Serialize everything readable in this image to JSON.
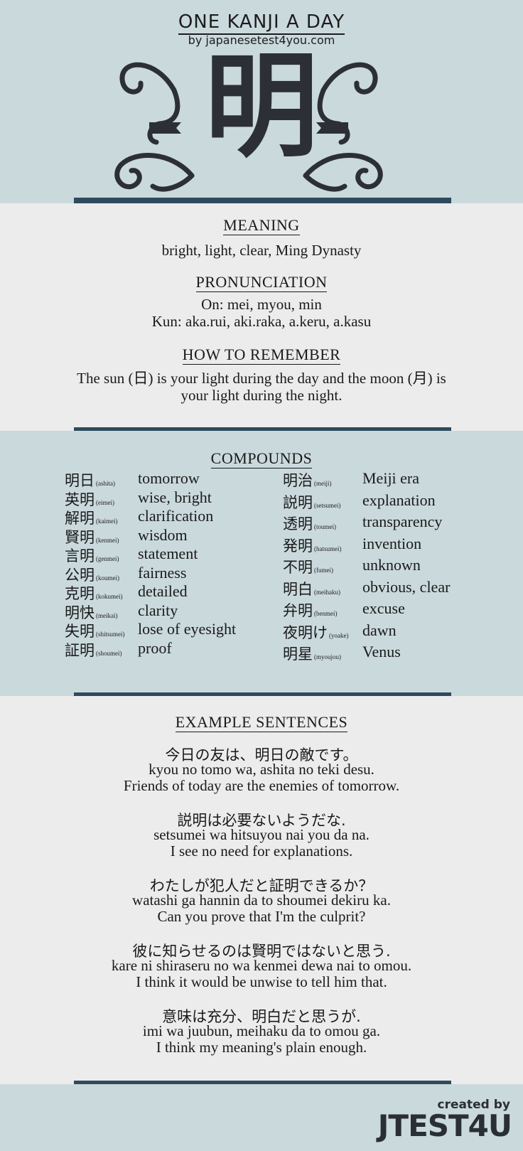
{
  "header": {
    "title": "ONE KANJI A DAY",
    "subtitle": "by japanesetest4you.com",
    "kanji": "明"
  },
  "meaning": {
    "heading": "MEANING",
    "text": "bright, light, clear, Ming Dynasty"
  },
  "pronunciation": {
    "heading": "PRONUNCIATION",
    "on": "On: mei, myou, min",
    "kun": "Kun: aka.rui, aki.raka, a.keru, a.kasu"
  },
  "remember": {
    "heading": "HOW TO REMEMBER",
    "line1": "The sun (日) is your light during the day and the moon (月) is",
    "line2": "your light during the night."
  },
  "compounds": {
    "heading": "COMPOUNDS",
    "left": [
      {
        "kanji": "明日",
        "reading": "(ashita)",
        "meaning": "tomorrow"
      },
      {
        "kanji": "英明",
        "reading": "(eimei)",
        "meaning": "wise, bright"
      },
      {
        "kanji": "解明",
        "reading": "(kaimei)",
        "meaning": "clarification"
      },
      {
        "kanji": "賢明",
        "reading": "(kenmei)",
        "meaning": "wisdom"
      },
      {
        "kanji": "言明",
        "reading": "(genmei)",
        "meaning": "statement"
      },
      {
        "kanji": "公明",
        "reading": "(koumei)",
        "meaning": "fairness"
      },
      {
        "kanji": "克明",
        "reading": "(kokumei)",
        "meaning": "detailed"
      },
      {
        "kanji": "明快",
        "reading": "(meikai)",
        "meaning": "clarity"
      },
      {
        "kanji": "失明",
        "reading": "(shitsumei)",
        "meaning": "lose of eyesight"
      },
      {
        "kanji": "証明",
        "reading": "(shoumei)",
        "meaning": "proof"
      }
    ],
    "right": [
      {
        "kanji": "明治",
        "reading": "(meiji)",
        "meaning": "Meiji era"
      },
      {
        "kanji": "説明",
        "reading": "(setsumei)",
        "meaning": "explanation"
      },
      {
        "kanji": "透明",
        "reading": "(toumei)",
        "meaning": "transparency"
      },
      {
        "kanji": "発明",
        "reading": "(hatsumei)",
        "meaning": "invention"
      },
      {
        "kanji": "不明",
        "reading": "(fumei)",
        "meaning": "unknown"
      },
      {
        "kanji": "明白",
        "reading": "(meihaku)",
        "meaning": "obvious, clear"
      },
      {
        "kanji": "弁明",
        "reading": "(benmei)",
        "meaning": "excuse"
      },
      {
        "kanji": "夜明け",
        "reading": "(yoake)",
        "meaning": "dawn"
      },
      {
        "kanji": "明星",
        "reading": "(myoujou)",
        "meaning": "Venus"
      }
    ]
  },
  "examples": {
    "heading": "EXAMPLE SENTENCES",
    "items": [
      {
        "jp": "今日の友は、明日の敵です。",
        "romaji": "kyou no tomo wa, ashita no teki desu.",
        "en": "Friends of today are the enemies of tomorrow."
      },
      {
        "jp": "説明は必要ないようだな.",
        "romaji": "setsumei wa hitsuyou nai you da na.",
        "en": "I see no need for explanations."
      },
      {
        "jp": "わたしが犯人だと証明できるか？",
        "romaji": "watashi ga hannin da to shoumei dekiru ka.",
        "en": "Can you prove that I'm the culprit?"
      },
      {
        "jp": "彼に知らせるのは賢明ではないと思う.",
        "romaji": "kare ni shiraseru no wa kenmei dewa nai to omou.",
        "en": "I think it would be unwise to tell him that."
      },
      {
        "jp": "意味は充分、明白だと思うが.",
        "romaji": "imi wa juubun, meihaku da to omou ga.",
        "en": "I think my meaning's plain enough."
      }
    ]
  },
  "footer": {
    "created_by": "created by",
    "brand": "JTEST4U"
  },
  "colors": {
    "band_blue": "#cad9dc",
    "band_gray": "#ececec",
    "divider": "#2f4a5c",
    "text": "#1a1a1a"
  }
}
